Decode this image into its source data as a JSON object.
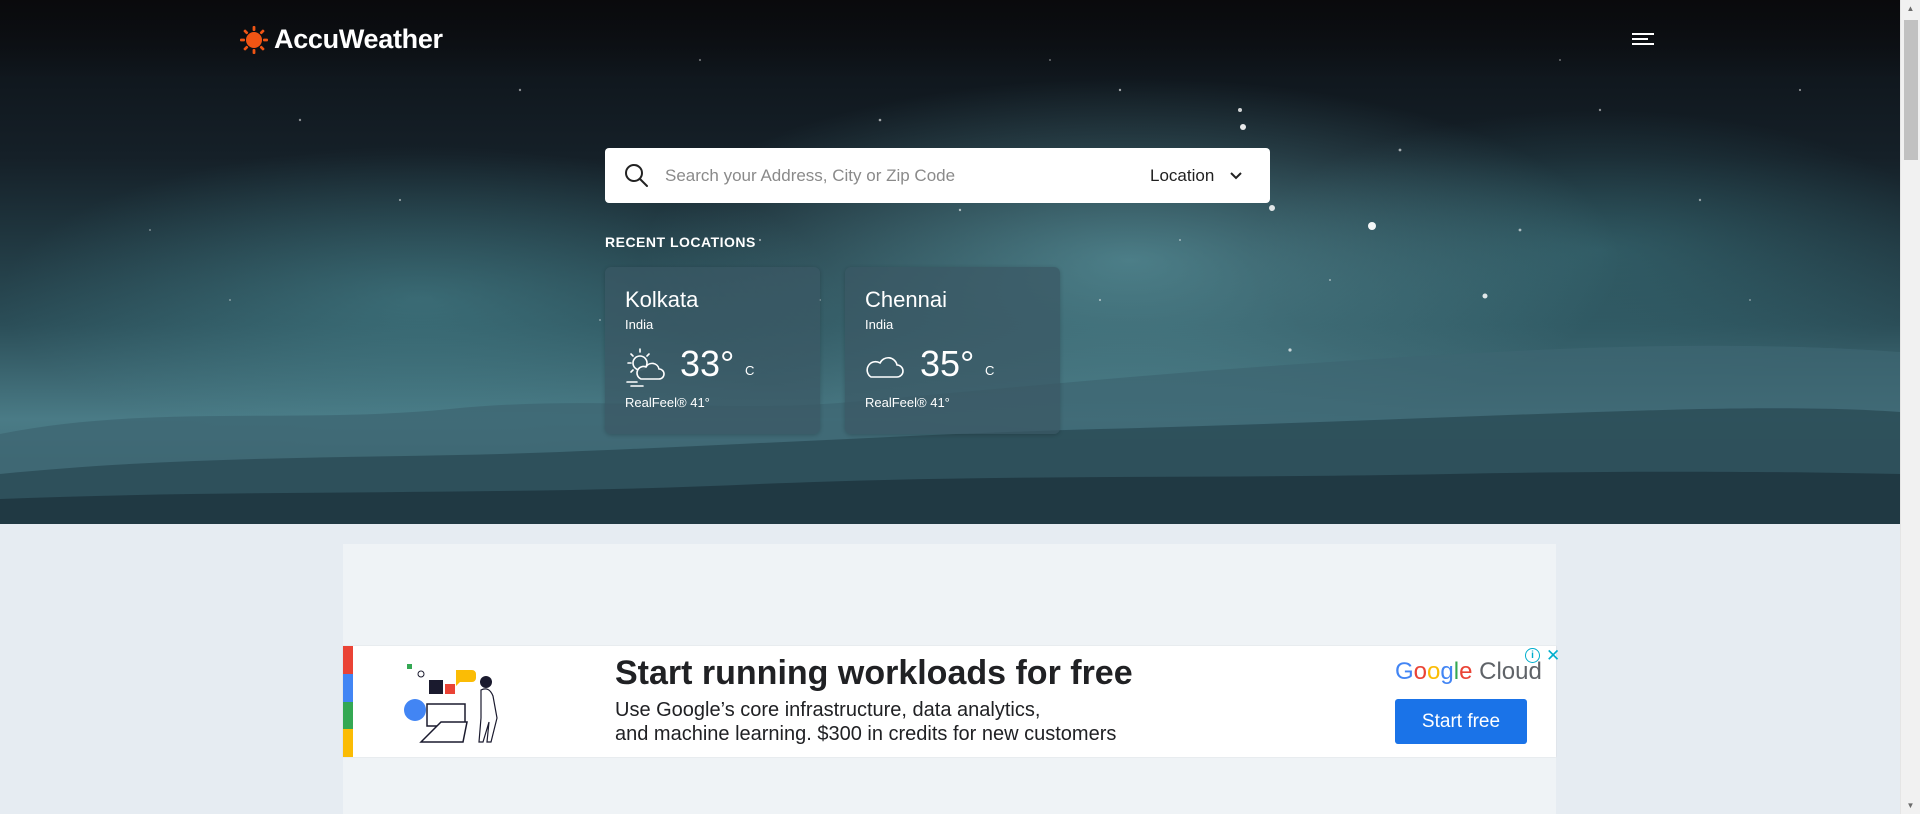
{
  "header": {
    "brand": "AccuWeather",
    "brand_color": "#f05514",
    "menu_icon": "hamburger-menu-icon"
  },
  "search": {
    "placeholder": "Search your Address, City or Zip Code",
    "value": "",
    "location_label": "Location"
  },
  "recent": {
    "heading": "RECENT LOCATIONS",
    "locations": [
      {
        "city": "Kolkata",
        "country": "India",
        "temp": "33°",
        "unit": "C",
        "realfeel": "RealFeel® 41°",
        "icon": "partly-sunny-cloud-icon"
      },
      {
        "city": "Chennai",
        "country": "India",
        "temp": "35°",
        "unit": "C",
        "realfeel": "RealFeel® 41°",
        "icon": "cloudy-icon"
      }
    ]
  },
  "ad": {
    "headline": "Start running workloads for free",
    "body_line1": "Use Google’s core infrastructure, data analytics,",
    "body_line2": "and machine learning. $300 in credits for new customers",
    "brand_parts": [
      "G",
      "o",
      "o",
      "g",
      "l",
      "e",
      " Cloud"
    ],
    "cta": "Start free",
    "cta_color": "#1a73e8",
    "info_icon": "i",
    "close_icon": "✕"
  }
}
